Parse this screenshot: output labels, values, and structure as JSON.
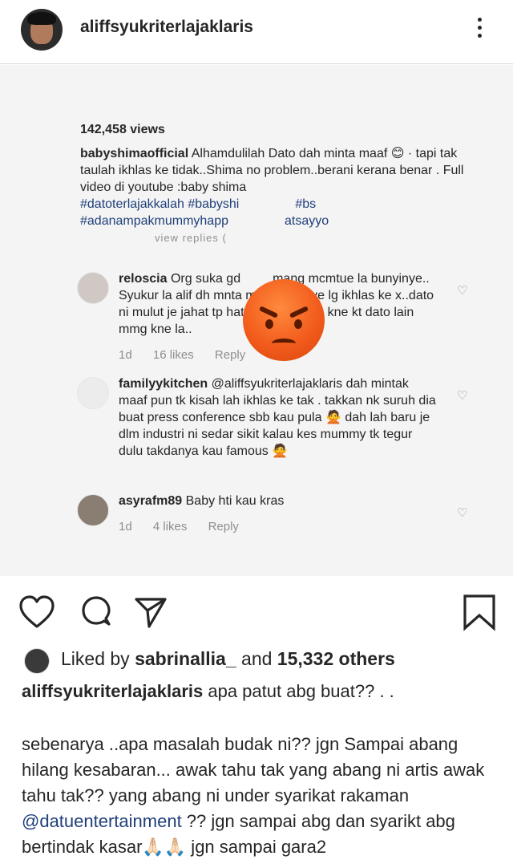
{
  "header": {
    "username": "aliffsyukriterlajaklaris",
    "more_label": "⋮"
  },
  "screenshot": {
    "views": "142,458 views",
    "caption_user": "babyshimaofficial",
    "caption_text": "Alhamdulilah Dato dah minta maaf 😊 · tapi tak taulah ikhlas ke tidak..Shima no problem..berani kerana benar . Full video di youtube :baby shima",
    "caption_tags_line1": "#datoterlajakkalah #babyshi",
    "caption_tags_line1b": "#bs",
    "caption_tags_line2": "#adanampakmummyhapp",
    "caption_tags_line2b": "atsayyo",
    "view_replies": "view replies (",
    "comments": [
      {
        "user": "reloscia",
        "text": "Org suka gd",
        "text_rest": "mang mcmtue la bunyinye.. Syukur la alif dh mnta maaf.. Ni tnye lg ikhlas ke x..dato ni mulut je jahat tp hati dia baik.. Klu kne kt dato lain mmg kne la..",
        "time": "1d",
        "likes": "16 likes",
        "reply": "Reply"
      },
      {
        "user": "familyykitchen",
        "text": "@aliffsyukriterlajaklaris dah mintak maaf pun tk kisah lah ikhlas ke tak . takkan nk suruh dia buat press conference sbb kau pula 🙅 dah lah baru je dlm industri ni sedar sikit kalau kes mummy tk tegur dulu takdanya kau famous 🙅"
      },
      {
        "user": "asyrafm89",
        "text": "Baby hti kau kras",
        "time": "1d",
        "likes": "4 likes",
        "reply": "Reply"
      }
    ]
  },
  "likes": {
    "prefix": "Liked by ",
    "user": "sabrinallia_",
    "middle": " and ",
    "count": "15,332 others"
  },
  "post": {
    "user": "aliffsyukriterlajaklaris",
    "caption": " apa patut abg buat?? . .",
    "body_1": "sebenarya ..apa masalah budak ni?? jgn Sampai abang hilang kesabaran... awak tahu tak yang abang ni artis awak tahu tak?? yang abang ni under syarikat rakaman ",
    "mention": "@datuentertainment",
    "body_2": " ?? jgn sampai abg dan syarikt abg bertindak kasar🙏🏻🙏🏻 jgn sampai gara2"
  },
  "colors": {
    "link": "#1f3f7a",
    "muted": "#8e8e8e",
    "text": "#262626",
    "emoji_orange": "#f25c1c"
  },
  "icons": [
    "more-options-icon",
    "heart-icon",
    "comment-icon",
    "share-icon",
    "bookmark-icon",
    "angry-face-emoji"
  ]
}
